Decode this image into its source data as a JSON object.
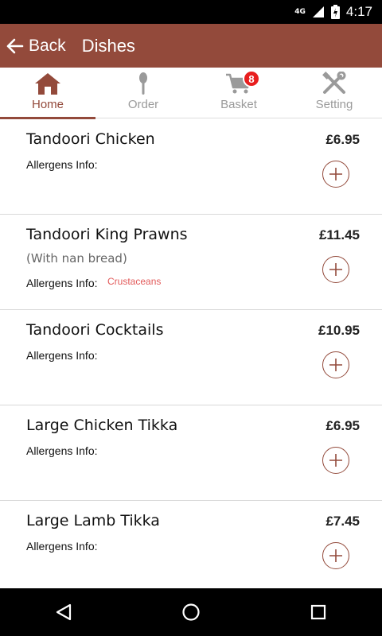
{
  "status": {
    "network": "4G",
    "time": "4:17"
  },
  "appbar": {
    "back_label": "Back",
    "title": "Dishes"
  },
  "tabs": [
    {
      "label": "Home",
      "icon": "home-icon",
      "active": true
    },
    {
      "label": "Order",
      "icon": "spoon-icon",
      "active": false
    },
    {
      "label": "Basket",
      "icon": "cart-icon",
      "badge": "8",
      "active": false
    },
    {
      "label": "Setting",
      "icon": "tools-icon",
      "active": false
    }
  ],
  "allergens_label": "Allergens Info:",
  "dishes": [
    {
      "name": "Tandoori Chicken",
      "subtitle": "",
      "price": "£6.95",
      "allergens": ""
    },
    {
      "name": "Tandoori King Prawns",
      "subtitle": "(With nan bread)",
      "price": "£11.45",
      "allergens": "Crustaceans"
    },
    {
      "name": "Tandoori Cocktails",
      "subtitle": "",
      "price": "£10.95",
      "allergens": ""
    },
    {
      "name": "Large Chicken Tikka",
      "subtitle": "",
      "price": "£6.95",
      "allergens": ""
    },
    {
      "name": "Large Lamb Tikka",
      "subtitle": "",
      "price": "£7.45",
      "allergens": ""
    }
  ],
  "colors": {
    "brand": "#934a3b",
    "badge": "#e81e1e",
    "allergen": "#e25a5a"
  }
}
